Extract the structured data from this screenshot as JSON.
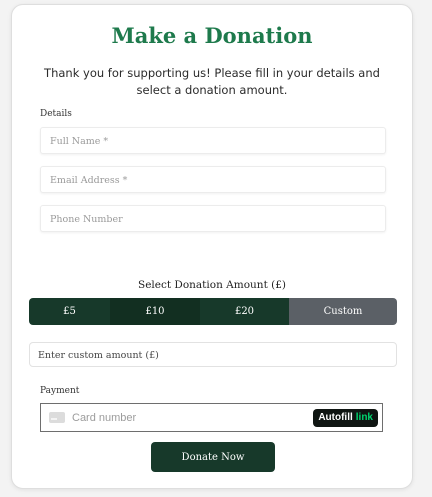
{
  "form": {
    "title": "Make a Donation",
    "intro": "Thank you for supporting us! Please fill in your details and select a donation amount.",
    "details_label": "Details",
    "full_name_placeholder": "Full Name *",
    "email_placeholder": "Email Address *",
    "phone_placeholder": "Phone Number"
  },
  "amount": {
    "heading": "Select Donation Amount (£)",
    "options": [
      "£5",
      "£10",
      "£20",
      "Custom"
    ],
    "custom_placeholder": "Enter custom amount (£)"
  },
  "payment": {
    "label": "Payment",
    "card_placeholder": "Card number",
    "autofill_label": "Autofill",
    "link_label": "link"
  },
  "actions": {
    "donate_label": "Donate Now"
  },
  "colors": {
    "title_green": "#1e7a4c",
    "button_dark_green": "#17392a",
    "custom_gray": "#5b6066",
    "link_green": "#00d66f"
  }
}
